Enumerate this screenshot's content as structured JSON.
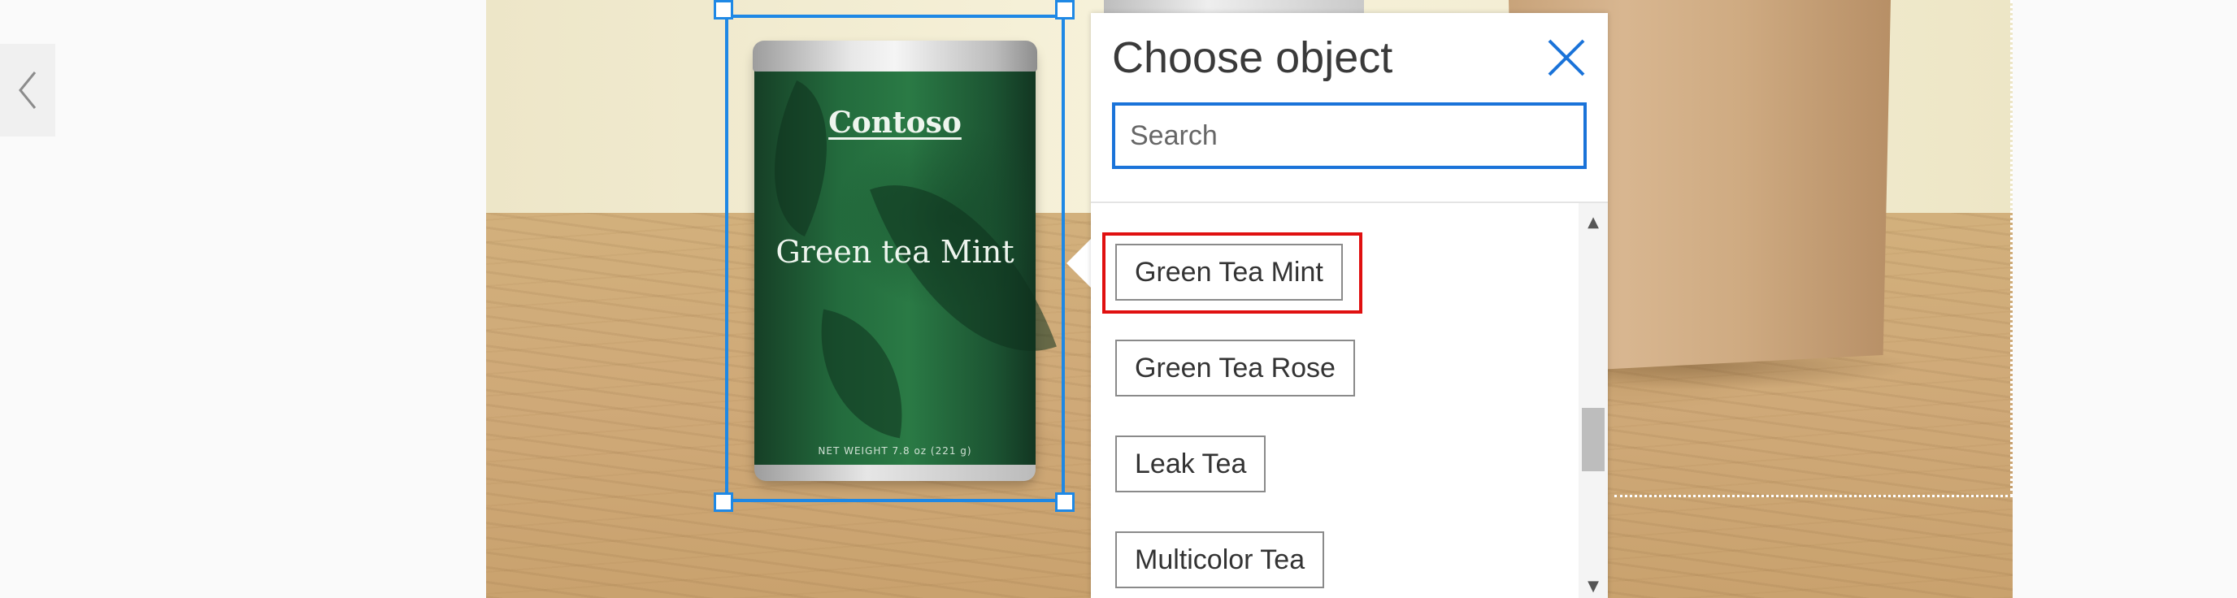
{
  "popup": {
    "title": "Choose object",
    "close_icon": "close-icon",
    "search": {
      "placeholder": "Search",
      "value": ""
    },
    "items": [
      {
        "label": "Green Tea Mint",
        "highlighted": true
      },
      {
        "label": "Green Tea Rose",
        "highlighted": false
      },
      {
        "label": "Leak Tea",
        "highlighted": false
      },
      {
        "label": "Multicolor Tea",
        "highlighted": false
      }
    ],
    "highlight_color": "#e01010"
  },
  "canvas": {
    "tea_can": {
      "brand": "Contoso",
      "product": "Green tea Mint",
      "weight": "NET WEIGHT 7.8 oz (221 g)"
    },
    "selection_color": "#1e88e5"
  },
  "nav": {
    "prev_icon": "chevron-left-icon"
  }
}
